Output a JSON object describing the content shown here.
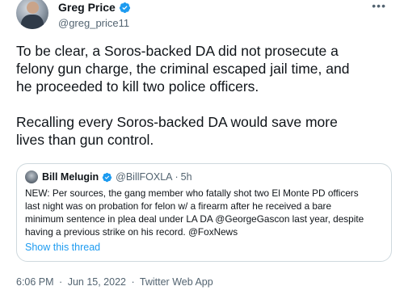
{
  "author": {
    "display_name": "Greg Price",
    "handle": "@greg_price11",
    "verified": true,
    "verified_color": "#1d9bf0",
    "avatar_icon": "user-avatar"
  },
  "more_menu_icon": "more-icon",
  "tweet": {
    "paragraph1_lines": [
      "To be clear, a Soros-backed DA did not prosecute a",
      "felony gun charge, the criminal escaped jail time, and",
      "he proceeded to kill two police officers."
    ],
    "paragraph2_lines": [
      "Recalling every Soros-backed DA would save more",
      "lives than gun control."
    ]
  },
  "quoted_tweet": {
    "display_name": "Bill Melugin",
    "handle": "@BillFOXLA",
    "separator": "·",
    "time": "5h",
    "verified": true,
    "text_lines": [
      "NEW: Per sources, the gang member who fatally shot two El Monte PD officers",
      "last night was on probation for felon w/ a firearm after he received a bare",
      "minimum sentence in plea deal under LA DA @GeorgeGascon last year, despite",
      "having a previous strike on his record. @FoxNews"
    ],
    "show_thread_label": "Show this thread",
    "link_color": "#1d9bf0"
  },
  "meta": {
    "time": "6:06 PM",
    "separator": "·",
    "date": "Jun 15, 2022",
    "source": "Twitter Web App"
  }
}
